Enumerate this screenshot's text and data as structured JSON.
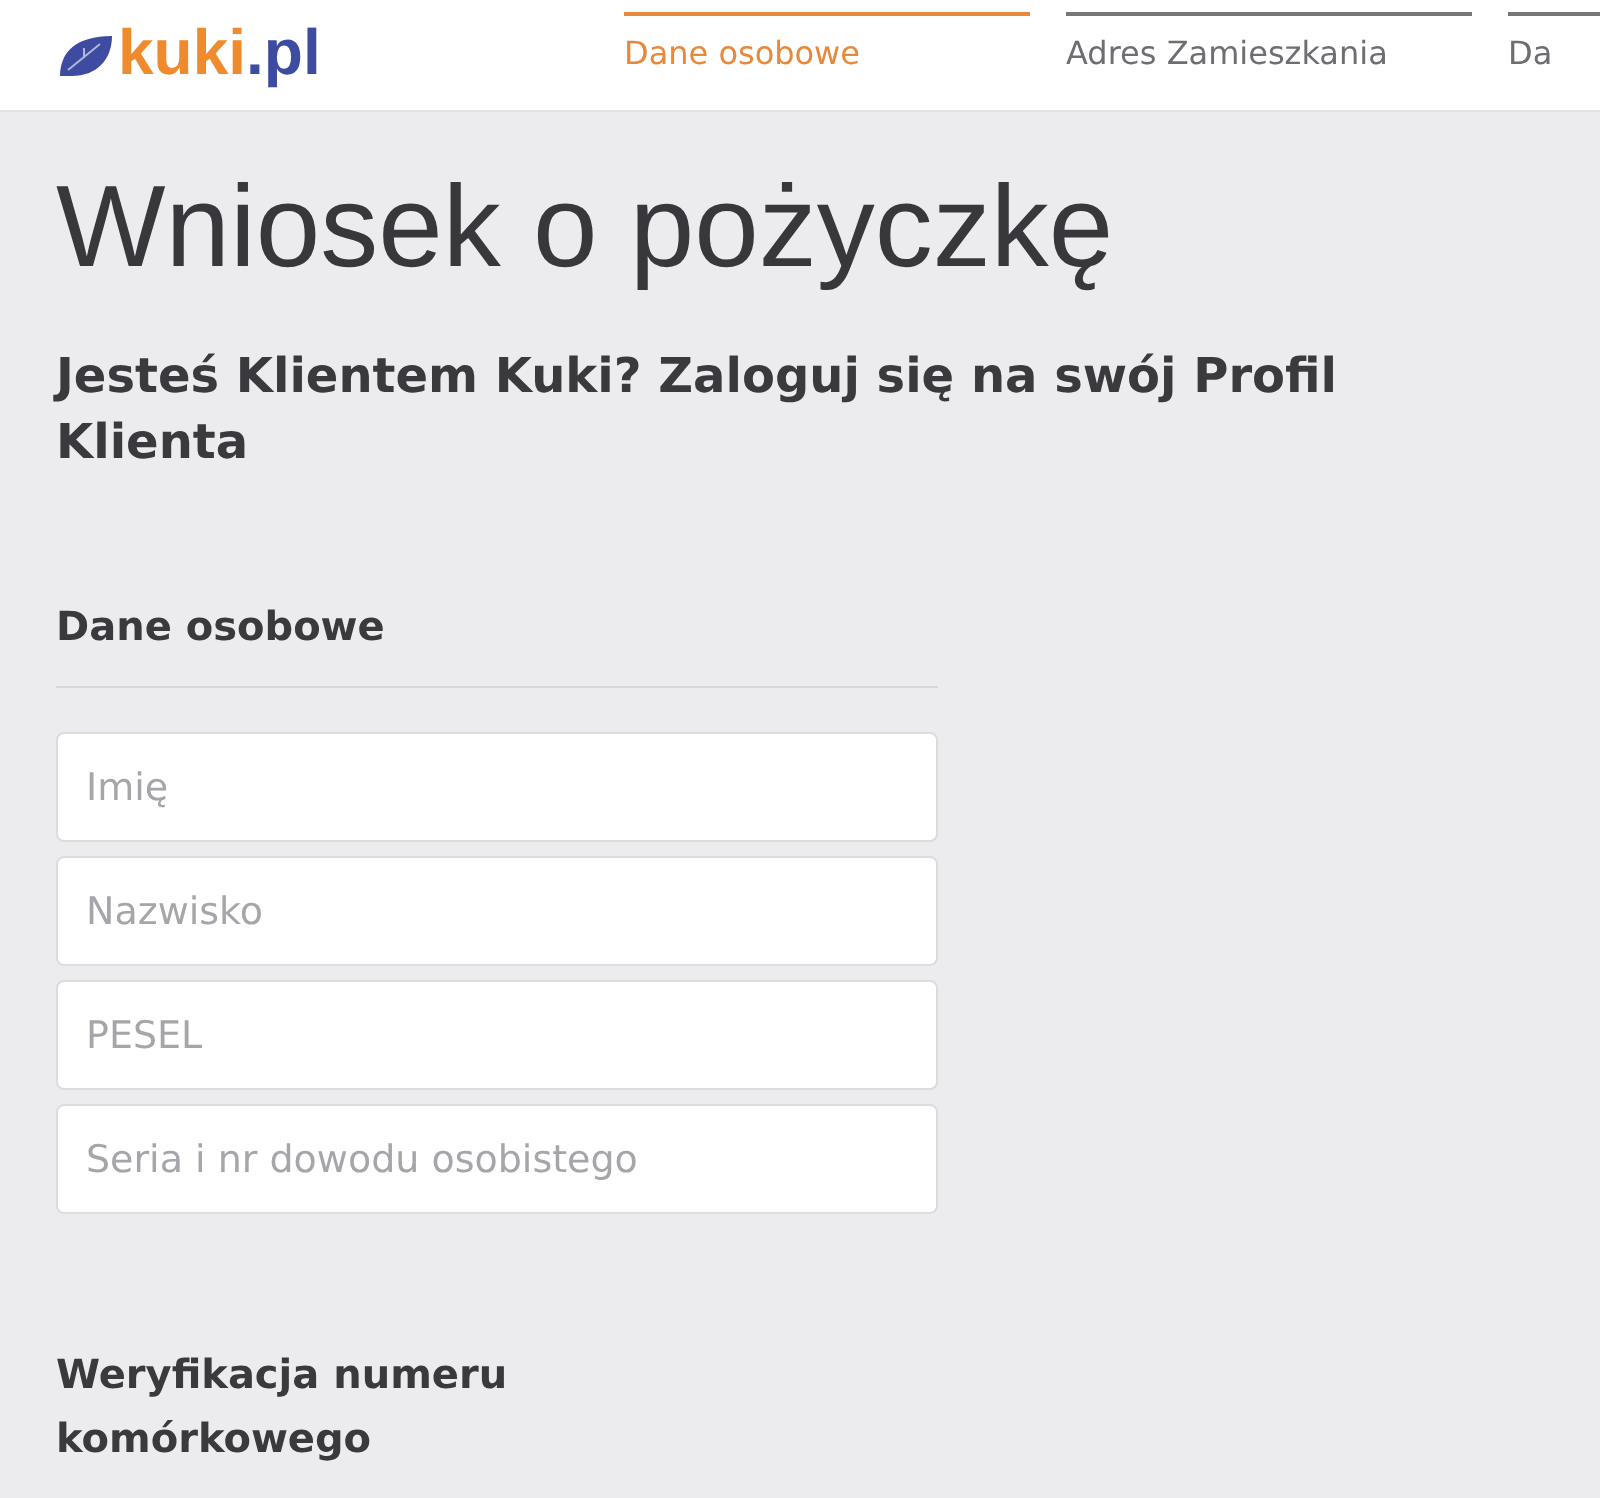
{
  "header": {
    "logo": {
      "brand": "kuki",
      "domain": ".pl"
    },
    "steps": [
      {
        "label": "Dane osobowe",
        "selected": true
      },
      {
        "label": "Adres Zamieszkania",
        "selected": false
      },
      {
        "label": "Da",
        "selected": false
      }
    ]
  },
  "title": "Wniosek o pożyczkę",
  "login_prompt": "Jesteś Klientem Kuki? Zaloguj się na swój Profil Klienta",
  "sections": [
    {
      "heading": "Dane osobowe",
      "fields": [
        {
          "placeholder": "Imię"
        },
        {
          "placeholder": "Nazwisko"
        },
        {
          "placeholder": "PESEL"
        },
        {
          "placeholder": "Seria i nr dowodu osobistego"
        }
      ]
    },
    {
      "heading": "Weryfikacja numeru komórkowego"
    }
  ]
}
